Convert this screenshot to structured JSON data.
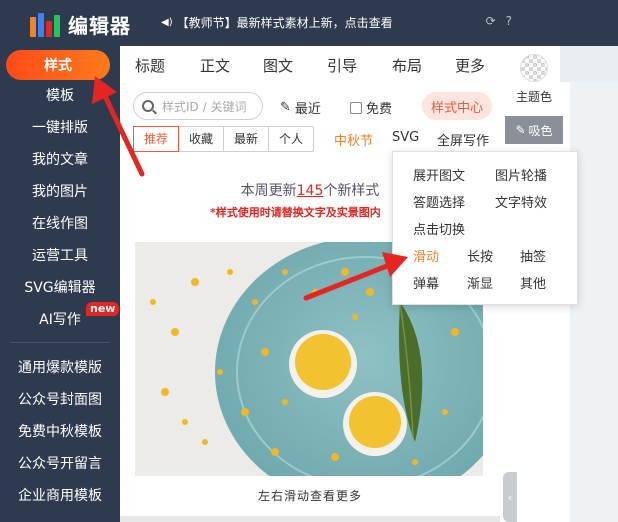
{
  "brand": {
    "title": "编辑器",
    "logo_colors": [
      "#f0832a",
      "#3b82f6",
      "#e52521",
      "#22c55e"
    ]
  },
  "announcement": "【教师节】最新样式素材上新，点击查看",
  "top_icons": [
    "refresh-icon",
    "help-icon"
  ],
  "sidebar": {
    "items": [
      {
        "label": "样式",
        "active": true
      },
      {
        "label": "模板"
      },
      {
        "label": "一键排版"
      },
      {
        "label": "我的文章"
      },
      {
        "label": "我的图片"
      },
      {
        "label": "在线作图"
      },
      {
        "label": "运营工具"
      },
      {
        "label": "SVG编辑器"
      },
      {
        "label": "AI写作",
        "badge": "new"
      },
      {
        "label": "通用爆款模版"
      },
      {
        "label": "公众号封面图"
      },
      {
        "label": "免费中秋模板"
      },
      {
        "label": "公众号开留言"
      },
      {
        "label": "企业商用模板"
      }
    ]
  },
  "tabs": [
    "标题",
    "正文",
    "图文",
    "引导",
    "布局",
    "更多"
  ],
  "search": {
    "placeholder": "样式ID / 关键词"
  },
  "toolbar": {
    "recent": "最近",
    "free": "免费",
    "style_center": "样式中心"
  },
  "filters": {
    "group": [
      "推荐",
      "收藏",
      "最新",
      "个人"
    ],
    "active": "推荐",
    "festival": "中秋节",
    "svg": "SVG",
    "fullscreen": "全屏写作"
  },
  "notice": {
    "prefix": "本周更新",
    "count": "145",
    "suffix": "个新样式",
    "warning": "*样式使用时请替换文字及实景图内"
  },
  "preview_caption": "左右滑动查看更多",
  "right_panel": {
    "theme_label": "主题色",
    "picker_label": "吸色"
  },
  "dropdown": {
    "items": [
      {
        "label": "展开图文"
      },
      {
        "label": "图片轮播"
      },
      {
        "label": "答题选择"
      },
      {
        "label": "文字特效"
      },
      {
        "label": "点击切换"
      },
      {
        "label": "滑动",
        "highlight": true
      },
      {
        "label": "长按"
      },
      {
        "label": "抽签"
      },
      {
        "label": "弹幕"
      },
      {
        "label": "渐显"
      },
      {
        "label": "其他"
      }
    ]
  },
  "colors": {
    "accent": "#f05a3a",
    "highlight": "#f0832a",
    "sidebar_bg": "#2e3a4e",
    "arrow": "#e52521"
  }
}
